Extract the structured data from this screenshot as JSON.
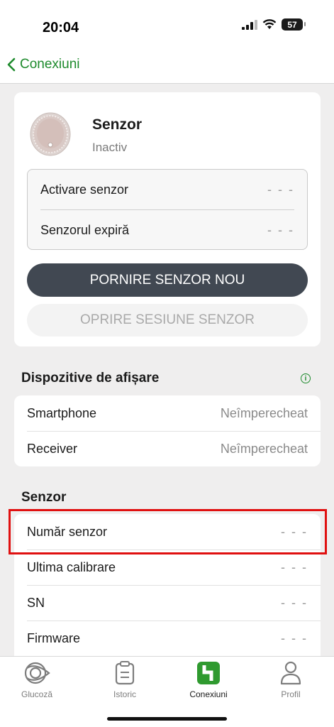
{
  "status_bar": {
    "time": "20:04",
    "battery": "57"
  },
  "nav": {
    "back_label": "Conexiuni"
  },
  "sensor_card": {
    "title": "Senzor",
    "status": "Inactiv",
    "rows": [
      {
        "label": "Activare senzor",
        "value": "- - -"
      },
      {
        "label": "Senzorul expiră",
        "value": "- - -"
      }
    ],
    "start_button": "PORNIRE SENZOR NOU",
    "stop_button": "OPRIRE SESIUNE SENZOR"
  },
  "display_devices": {
    "title": "Dispozitive de afișare",
    "rows": [
      {
        "label": "Smartphone",
        "value": "Neîmperecheat"
      },
      {
        "label": "Receiver",
        "value": "Neîmperecheat"
      }
    ]
  },
  "sensor_section": {
    "title": "Senzor",
    "rows": [
      {
        "label": "Număr senzor",
        "value": "- - -"
      },
      {
        "label": "Ultima calibrare",
        "value": "- - -"
      },
      {
        "label": "SN",
        "value": "- - -"
      },
      {
        "label": "Firmware",
        "value": "- - -"
      }
    ]
  },
  "tabbar": {
    "tabs": [
      {
        "label": "Glucoză",
        "icon": "glucose-icon"
      },
      {
        "label": "Istoric",
        "icon": "clipboard-icon"
      },
      {
        "label": "Conexiuni",
        "icon": "connections-icon"
      },
      {
        "label": "Profil",
        "icon": "person-icon"
      }
    ],
    "active": "Conexiuni"
  },
  "colors": {
    "accent": "#1d8a2c",
    "primary_button": "#414852",
    "highlight": "#e01010"
  }
}
